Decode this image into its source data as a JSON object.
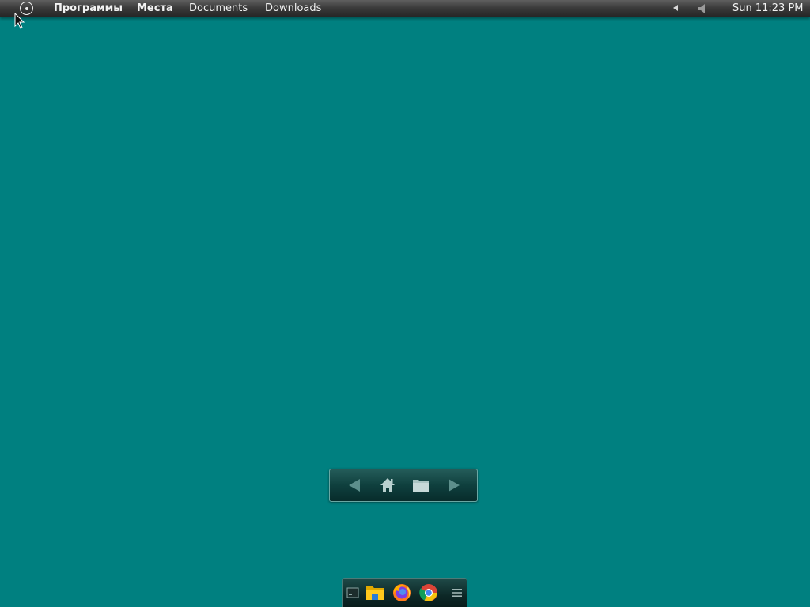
{
  "top_panel": {
    "menus": [
      "Программы",
      "Места",
      "Documents",
      "Downloads"
    ],
    "clock": "Sun 11:23 PM",
    "icons": {
      "app_button": "applications-circle-icon",
      "tray_arrow": "tray-arrow-left-icon",
      "volume": "volume-icon"
    }
  },
  "desktop": {
    "background_color": "#008080"
  },
  "nav_toolbar": {
    "buttons": [
      "back-arrow-icon",
      "home-icon",
      "folder-icon",
      "forward-arrow-icon"
    ]
  },
  "dock": {
    "items": [
      "terminal-icon",
      "file-manager-icon",
      "firefox-icon",
      "chrome-icon",
      "dock-menu-icon"
    ]
  }
}
